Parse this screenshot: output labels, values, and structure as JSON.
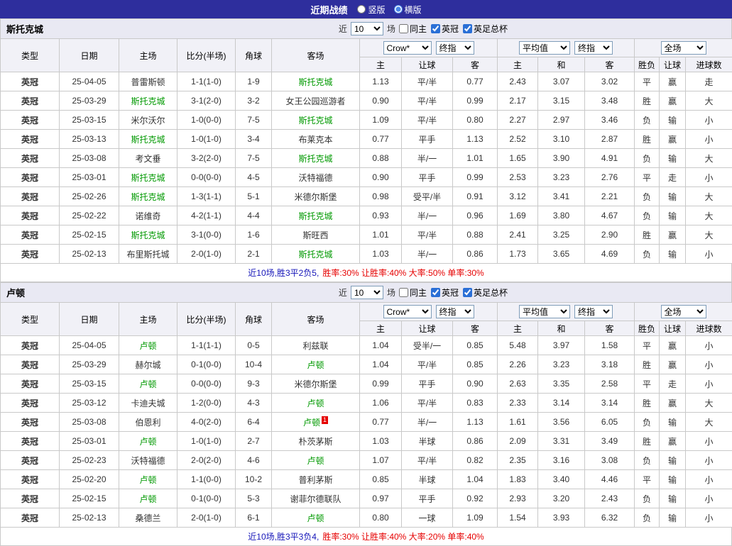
{
  "topbar": {
    "title": "近期战绩",
    "layout_options": [
      {
        "label": "竖版",
        "selected": false
      },
      {
        "label": "横版",
        "selected": true
      }
    ]
  },
  "table_header": {
    "static_cols": [
      "类型",
      "日期",
      "主场",
      "比分(半场)",
      "角球",
      "客场"
    ],
    "odds1": {
      "selects": [
        "Crow*",
        "终指"
      ],
      "cols": [
        "主",
        "让球",
        "客"
      ]
    },
    "odds2": {
      "selects": [
        "平均值",
        "终指"
      ],
      "cols": [
        "主",
        "和",
        "客"
      ]
    },
    "result": {
      "selects": [
        "全场"
      ],
      "cols": [
        "胜负",
        "让球",
        "进球数"
      ]
    }
  },
  "colors": {
    "accent_bar": "#2e2e9d",
    "league_badge": "#e8431d",
    "focus_team": "#009900",
    "win_red": "#e60000",
    "lose_green": "#009900"
  },
  "sections": [
    {
      "team": "斯托克城",
      "filter": {
        "prefix": "近",
        "count": "10",
        "suffix": "场",
        "checkboxes": [
          {
            "label": "同主",
            "checked": false
          },
          {
            "label": "英冠",
            "checked": true
          },
          {
            "label": "英足总杯",
            "checked": true
          }
        ]
      },
      "rows": [
        {
          "league": "英冠",
          "date": "25-04-05",
          "home": "普雷斯顿",
          "score": "1-1(1-0)",
          "corners": "1-9",
          "away": "斯托克城",
          "focus": "away",
          "odds": [
            "1.13",
            "0.77"
          ],
          "handicap": "平/半",
          "hcolor": "r",
          "avg": [
            "2.43",
            "3.07",
            "3.02"
          ],
          "results": [
            [
              "平",
              "g"
            ],
            [
              "赢",
              "r"
            ],
            [
              "走",
              "g"
            ]
          ]
        },
        {
          "league": "英冠",
          "date": "25-03-29",
          "home": "斯托克城",
          "score": "3-1(2-0)",
          "corners": "3-2",
          "away": "女王公园巡游者",
          "focus": "home",
          "odds": [
            "0.90",
            "0.99"
          ],
          "handicap": "平/半",
          "hcolor": "r",
          "avg": [
            "2.17",
            "3.15",
            "3.48"
          ],
          "results": [
            [
              "胜",
              "r"
            ],
            [
              "赢",
              "r"
            ],
            [
              "大",
              "r"
            ]
          ]
        },
        {
          "league": "英冠",
          "date": "25-03-15",
          "home": "米尔沃尔",
          "score": "1-0(0-0)",
          "corners": "7-5",
          "away": "斯托克城",
          "focus": "away",
          "odds": [
            "1.09",
            "0.80"
          ],
          "handicap": "平/半",
          "hcolor": "r",
          "avg": [
            "2.27",
            "2.97",
            "3.46"
          ],
          "results": [
            [
              "负",
              "g"
            ],
            [
              "输",
              "g"
            ],
            [
              "小",
              "g"
            ]
          ]
        },
        {
          "league": "英冠",
          "date": "25-03-13",
          "home": "斯托克城",
          "score": "1-0(1-0)",
          "corners": "3-4",
          "away": "布莱克本",
          "focus": "home",
          "odds": [
            "0.77",
            "1.13"
          ],
          "handicap": "平手",
          "hcolor": "k",
          "avg": [
            "2.52",
            "3.10",
            "2.87"
          ],
          "results": [
            [
              "胜",
              "r"
            ],
            [
              "赢",
              "r"
            ],
            [
              "小",
              "g"
            ]
          ]
        },
        {
          "league": "英冠",
          "date": "25-03-08",
          "home": "考文垂",
          "score": "3-2(2-0)",
          "corners": "7-5",
          "away": "斯托克城",
          "focus": "away",
          "odds": [
            "0.88",
            "1.01"
          ],
          "handicap": "半/一",
          "hcolor": "r",
          "avg": [
            "1.65",
            "3.90",
            "4.91"
          ],
          "results": [
            [
              "负",
              "g"
            ],
            [
              "输",
              "g"
            ],
            [
              "大",
              "r"
            ]
          ]
        },
        {
          "league": "英冠",
          "date": "25-03-01",
          "home": "斯托克城",
          "score": "0-0(0-0)",
          "corners": "4-5",
          "away": "沃特福德",
          "focus": "home",
          "odds": [
            "0.90",
            "0.99"
          ],
          "handicap": "平手",
          "hcolor": "k",
          "avg": [
            "2.53",
            "3.23",
            "2.76"
          ],
          "results": [
            [
              "平",
              "g"
            ],
            [
              "走",
              "g"
            ],
            [
              "小",
              "g"
            ]
          ]
        },
        {
          "league": "英冠",
          "date": "25-02-26",
          "home": "斯托克城",
          "score": "1-3(1-1)",
          "corners": "5-1",
          "away": "米德尔斯堡",
          "focus": "home",
          "odds": [
            "0.98",
            "0.91"
          ],
          "handicap": "受平/半",
          "hcolor": "r",
          "avg": [
            "3.12",
            "3.41",
            "2.21"
          ],
          "results": [
            [
              "负",
              "g"
            ],
            [
              "输",
              "g"
            ],
            [
              "大",
              "r"
            ]
          ]
        },
        {
          "league": "英冠",
          "date": "25-02-22",
          "home": "诺维奇",
          "score": "4-2(1-1)",
          "corners": "4-4",
          "away": "斯托克城",
          "focus": "away",
          "odds": [
            "0.93",
            "0.96"
          ],
          "handicap": "半/一",
          "hcolor": "r",
          "avg": [
            "1.69",
            "3.80",
            "4.67"
          ],
          "results": [
            [
              "负",
              "g"
            ],
            [
              "输",
              "g"
            ],
            [
              "大",
              "r"
            ]
          ]
        },
        {
          "league": "英冠",
          "date": "25-02-15",
          "home": "斯托克城",
          "score": "3-1(0-0)",
          "corners": "1-6",
          "away": "斯旺西",
          "focus": "home",
          "odds": [
            "1.01",
            "0.88"
          ],
          "handicap": "平/半",
          "hcolor": "r",
          "avg": [
            "2.41",
            "3.25",
            "2.90"
          ],
          "results": [
            [
              "胜",
              "r"
            ],
            [
              "赢",
              "r"
            ],
            [
              "大",
              "r"
            ]
          ]
        },
        {
          "league": "英冠",
          "date": "25-02-13",
          "home": "布里斯托城",
          "score": "2-0(1-0)",
          "corners": "2-1",
          "away": "斯托克城",
          "focus": "away",
          "odds": [
            "1.03",
            "0.86"
          ],
          "handicap": "半/一",
          "hcolor": "r",
          "avg": [
            "1.73",
            "3.65",
            "4.69"
          ],
          "results": [
            [
              "负",
              "g"
            ],
            [
              "输",
              "g"
            ],
            [
              "小",
              "g"
            ]
          ]
        }
      ],
      "summary": {
        "record": "近10场,胜3平2负5,",
        "rates": "胜率:30% 让胜率:40% 大率:50% 单率:30%"
      }
    },
    {
      "team": "卢顿",
      "filter": {
        "prefix": "近",
        "count": "10",
        "suffix": "场",
        "checkboxes": [
          {
            "label": "同主",
            "checked": false
          },
          {
            "label": "英冠",
            "checked": true
          },
          {
            "label": "英足总杯",
            "checked": true
          }
        ]
      },
      "rows": [
        {
          "league": "英冠",
          "date": "25-04-05",
          "home": "卢顿",
          "score": "1-1(1-1)",
          "corners": "0-5",
          "away": "利兹联",
          "focus": "home",
          "odds": [
            "1.04",
            "0.85"
          ],
          "handicap": "受半/一",
          "hcolor": "r",
          "avg": [
            "5.48",
            "3.97",
            "1.58"
          ],
          "results": [
            [
              "平",
              "g"
            ],
            [
              "赢",
              "r"
            ],
            [
              "小",
              "g"
            ]
          ]
        },
        {
          "league": "英冠",
          "date": "25-03-29",
          "home": "赫尔城",
          "score": "0-1(0-0)",
          "corners": "10-4",
          "away": "卢顿",
          "focus": "away",
          "odds": [
            "1.04",
            "0.85"
          ],
          "handicap": "平/半",
          "hcolor": "r",
          "avg": [
            "2.26",
            "3.23",
            "3.18"
          ],
          "results": [
            [
              "胜",
              "r"
            ],
            [
              "赢",
              "r"
            ],
            [
              "小",
              "g"
            ]
          ]
        },
        {
          "league": "英冠",
          "date": "25-03-15",
          "home": "卢顿",
          "score": "0-0(0-0)",
          "corners": "9-3",
          "away": "米德尔斯堡",
          "focus": "home",
          "odds": [
            "0.99",
            "0.90"
          ],
          "handicap": "平手",
          "hcolor": "k",
          "avg": [
            "2.63",
            "3.35",
            "2.58"
          ],
          "results": [
            [
              "平",
              "g"
            ],
            [
              "走",
              "g"
            ],
            [
              "小",
              "g"
            ]
          ]
        },
        {
          "league": "英冠",
          "date": "25-03-12",
          "home": "卡迪夫城",
          "score": "1-2(0-0)",
          "corners": "4-3",
          "away": "卢顿",
          "focus": "away",
          "odds": [
            "1.06",
            "0.83"
          ],
          "handicap": "平/半",
          "hcolor": "r",
          "avg": [
            "2.33",
            "3.14",
            "3.14"
          ],
          "results": [
            [
              "胜",
              "r"
            ],
            [
              "赢",
              "r"
            ],
            [
              "大",
              "r"
            ]
          ]
        },
        {
          "league": "英冠",
          "date": "25-03-08",
          "home": "伯恩利",
          "score": "4-0(2-0)",
          "corners": "6-4",
          "away": "卢顿",
          "focus": "away",
          "away_badge": "1",
          "odds": [
            "0.77",
            "1.13"
          ],
          "handicap": "半/一",
          "hcolor": "r",
          "avg": [
            "1.61",
            "3.56",
            "6.05"
          ],
          "results": [
            [
              "负",
              "g"
            ],
            [
              "输",
              "g"
            ],
            [
              "大",
              "r"
            ]
          ]
        },
        {
          "league": "英冠",
          "date": "25-03-01",
          "home": "卢顿",
          "score": "1-0(1-0)",
          "corners": "2-7",
          "away": "朴茨茅斯",
          "focus": "home",
          "odds": [
            "1.03",
            "0.86"
          ],
          "handicap": "半球",
          "hcolor": "r",
          "avg": [
            "2.09",
            "3.31",
            "3.49"
          ],
          "results": [
            [
              "胜",
              "r"
            ],
            [
              "赢",
              "r"
            ],
            [
              "小",
              "g"
            ]
          ]
        },
        {
          "league": "英冠",
          "date": "25-02-23",
          "home": "沃特福德",
          "score": "2-0(2-0)",
          "corners": "4-6",
          "away": "卢顿",
          "focus": "away",
          "odds": [
            "1.07",
            "0.82"
          ],
          "handicap": "平/半",
          "hcolor": "r",
          "avg": [
            "2.35",
            "3.16",
            "3.08"
          ],
          "results": [
            [
              "负",
              "g"
            ],
            [
              "输",
              "g"
            ],
            [
              "小",
              "g"
            ]
          ]
        },
        {
          "league": "英冠",
          "date": "25-02-20",
          "home": "卢顿",
          "score": "1-1(0-0)",
          "corners": "10-2",
          "away": "普利茅斯",
          "focus": "home",
          "odds": [
            "0.85",
            "1.04"
          ],
          "handicap": "半球",
          "hcolor": "r",
          "avg": [
            "1.83",
            "3.40",
            "4.46"
          ],
          "results": [
            [
              "平",
              "g"
            ],
            [
              "输",
              "g"
            ],
            [
              "小",
              "g"
            ]
          ]
        },
        {
          "league": "英冠",
          "date": "25-02-15",
          "home": "卢顿",
          "score": "0-1(0-0)",
          "corners": "5-3",
          "away": "谢菲尔德联队",
          "focus": "home",
          "odds": [
            "0.97",
            "0.92"
          ],
          "handicap": "平手",
          "hcolor": "k",
          "avg": [
            "2.93",
            "3.20",
            "2.43"
          ],
          "results": [
            [
              "负",
              "g"
            ],
            [
              "输",
              "g"
            ],
            [
              "小",
              "g"
            ]
          ]
        },
        {
          "league": "英冠",
          "date": "25-02-13",
          "home": "桑德兰",
          "score": "2-0(1-0)",
          "corners": "6-1",
          "away": "卢顿",
          "focus": "away",
          "odds": [
            "0.80",
            "1.09"
          ],
          "handicap": "一球",
          "hcolor": "r",
          "avg": [
            "1.54",
            "3.93",
            "6.32"
          ],
          "results": [
            [
              "负",
              "g"
            ],
            [
              "输",
              "g"
            ],
            [
              "小",
              "g"
            ]
          ]
        }
      ],
      "summary": {
        "record": "近10场,胜3平3负4,",
        "rates": "胜率:30% 让胜率:40% 大率:20% 单率:40%"
      }
    }
  ]
}
